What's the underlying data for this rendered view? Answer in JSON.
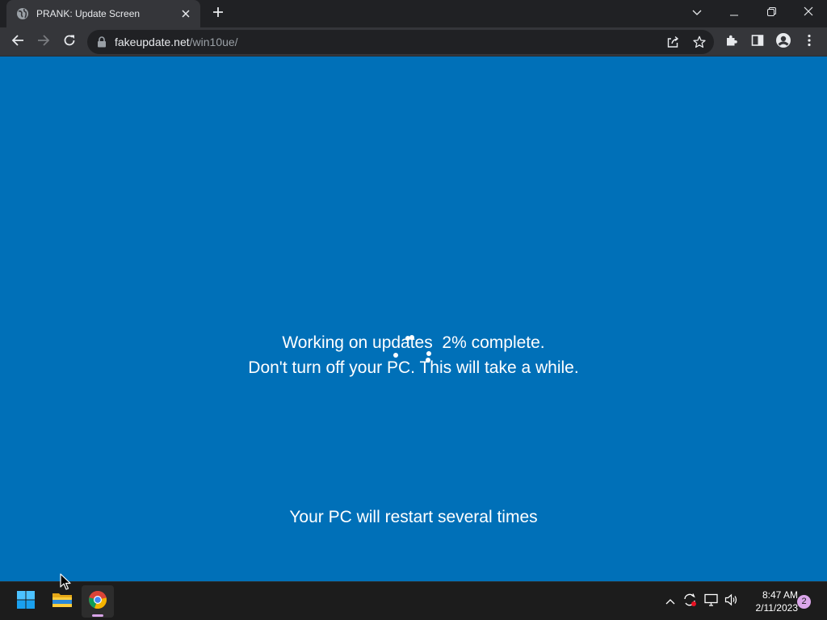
{
  "browser": {
    "tab": {
      "title": "PRANK: Update Screen",
      "favicon": "globe-icon",
      "close_icon": "close-icon"
    },
    "new_tab_icon": "plus-icon",
    "window_controls": [
      "chevron-down-icon",
      "minimize-icon",
      "restore-icon",
      "close-icon"
    ],
    "toolbar": {
      "back_icon": "arrow-left-icon",
      "forward_icon": "arrow-right-icon",
      "reload_icon": "reload-icon",
      "url_host": "fakeupdate.net",
      "url_path": "/win10ue/",
      "share_icon": "share-icon",
      "bookmark_icon": "star-icon",
      "extensions_icon": "puzzle-icon",
      "side_panel_icon": "side-panel-icon",
      "profile_icon": "profile-icon",
      "menu_icon": "kebab-menu-icon"
    }
  },
  "page": {
    "background": "#0070b8",
    "line1": "Working on updates  2% complete.",
    "line2": "Don't turn off your PC. This will take a while.",
    "footer": "Your PC will restart several times"
  },
  "taskbar": {
    "apps": [
      "windows-start-icon",
      "file-explorer-icon",
      "chrome-icon"
    ],
    "tray_icons": [
      "chevron-up-icon",
      "sync-icon",
      "display-icon",
      "volume-icon"
    ],
    "time": "8:47 AM",
    "date": "2/11/2023",
    "notification_count": "2"
  }
}
